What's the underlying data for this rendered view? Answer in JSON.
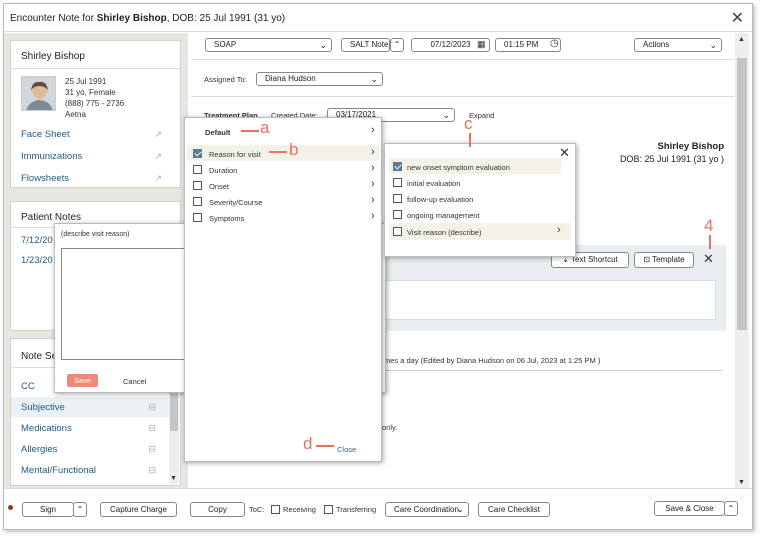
{
  "window": {
    "title_prefix": "Encounter Note for ",
    "title_main": "Shirley Bishop",
    "title_suffix": ", DOB: 25 Jul 1991 (31 yo)",
    "close_glyph": "✕"
  },
  "patient": {
    "name": "Shirley Bishop",
    "dob": "25 Jul 1991",
    "age_sex": "31 yo, Female",
    "phone": "(888) 775 - 2736",
    "insurance": "Aetna",
    "links": [
      "Face Sheet",
      "Immunizations",
      "Flowsheets"
    ]
  },
  "patient_notes": {
    "title": "Patient Notes",
    "items": [
      "7/12/20",
      "1/23/20"
    ]
  },
  "note_sections": {
    "title": "Note Se",
    "items": [
      "CC",
      "Subjective",
      "Medications",
      "Allergies",
      "Mental/Functional"
    ]
  },
  "toolbar": {
    "note_type": "SOAP",
    "salt_note": "SALT Note",
    "date": "07/12/2023",
    "time": "01:15 PM",
    "actions": "Actions"
  },
  "assigned": {
    "label": "Assigned To:",
    "value": "Diana Hudson"
  },
  "treatment": {
    "label": "Treatment Plan",
    "created_label": "Created Date:",
    "created_value": "03/17/2021",
    "expand": "Expand"
  },
  "header_right": {
    "name": "Shirley Bishop",
    "dob": "DOB: 25 Jul 1991 (31 yo )"
  },
  "section_tools": {
    "text_shortcut": "Text Shortcut",
    "template": "Template"
  },
  "body_text": {
    "edit_line": "mes a day (Edited by Diana Hudson on 06 Jul, 2023 at 1:25 PM )",
    "only": "only."
  },
  "menu1": {
    "items": [
      {
        "label": "Default",
        "bold": true,
        "checkbox": false,
        "checked": false
      },
      {
        "label": "Reason for visit",
        "bold": false,
        "checkbox": true,
        "checked": true
      },
      {
        "label": "Duration",
        "bold": false,
        "checkbox": true,
        "checked": false
      },
      {
        "label": "Onset",
        "bold": false,
        "checkbox": true,
        "checked": false
      },
      {
        "label": "Severity/Course",
        "bold": false,
        "checkbox": true,
        "checked": false
      },
      {
        "label": "Symptoms",
        "bold": false,
        "checkbox": true,
        "checked": false
      }
    ],
    "close": "Close"
  },
  "menu2": {
    "items": [
      {
        "label": "new onset symptom evaluation",
        "checked": true
      },
      {
        "label": "initial evaluation",
        "checked": false
      },
      {
        "label": "follow-up evaluation",
        "checked": false
      },
      {
        "label": "ongoing management",
        "checked": false
      },
      {
        "label": "Visit reason (describe)",
        "checked": false
      }
    ]
  },
  "describe_panel": {
    "title": "(describe visit reason)",
    "textarea_value": "",
    "save": "Save",
    "cancel": "Cancel"
  },
  "callouts": {
    "a": "a",
    "b": "b",
    "c": "c",
    "d": "d",
    "four": "4"
  },
  "footer": {
    "sign": "Sign",
    "capture_charge": "Capture Charge",
    "copy": "Copy",
    "toc_label": "ToC:",
    "receiving": "Receiving",
    "transferring": "Transferring",
    "care_coordination": "Care Coordination",
    "care_checklist": "Care Checklist",
    "save_close": "Save & Close"
  },
  "colors": {
    "accent": "#e8735a",
    "link": "#1e5a85",
    "checked": "#5a7c8c",
    "save_btn": "#f08a78"
  }
}
